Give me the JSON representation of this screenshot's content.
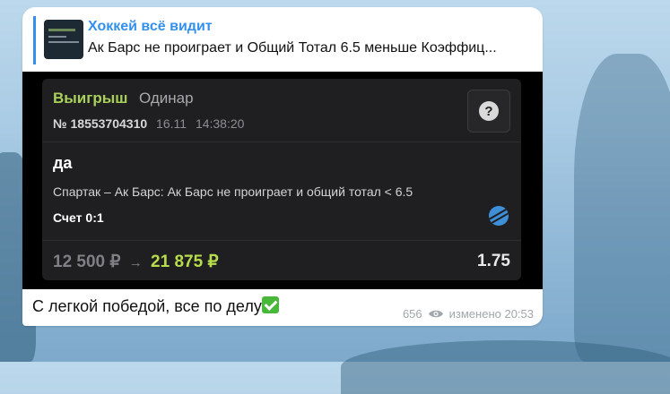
{
  "channel": {
    "name": "Хоккей всё видит"
  },
  "reply": {
    "title": "Хоккей всё видит",
    "text": "Ак Барс не проиграет и Общий Тотал 6.5 меньше Коэффиц..."
  },
  "bet_card": {
    "status": "Выигрыш",
    "bet_type": "Одинар",
    "ticket_number": "№ 18553704310",
    "date": "16.11",
    "time": "14:38:20",
    "help_icon": "question-icon",
    "outcome": "да",
    "event": "Спартак – Ак Барс: Ак Барс не проиграет и общий тотал < 6.5",
    "score": "Счет 0:1",
    "sport_icon": "puck-icon",
    "stake": "12 500 ₽",
    "arrow": "→",
    "payout": "21 875 ₽",
    "coefficient": "1.75",
    "colors": {
      "win": "#a8d05a",
      "payout": "#b7dd4c",
      "card_bg": "#1f1f21"
    }
  },
  "message": {
    "caption": "С легкой победой, все по делу",
    "emoji_icon": "check-mark-button-icon",
    "views": "656",
    "edited_time": "изменено 20:53"
  },
  "accent_color": "#3390ec"
}
